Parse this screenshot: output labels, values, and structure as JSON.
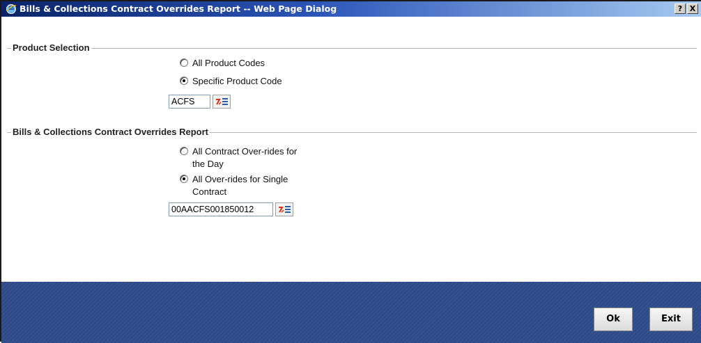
{
  "window": {
    "title": "Bills & Collections Contract Overrides Report -- Web Page Dialog",
    "help_label": "?",
    "close_label": "X"
  },
  "product_selection": {
    "section_title": "Product Selection",
    "options": [
      {
        "label": "All Product Codes",
        "checked": false
      },
      {
        "label": "Specific Product Code",
        "checked": true
      }
    ],
    "product_code_value": "ACFS"
  },
  "overrides_report": {
    "section_title": "Bills & Collections Contract Overrides Report",
    "options": [
      {
        "label_line1": "All Contract Over-rides for",
        "label_line2": "the Day",
        "checked": false
      },
      {
        "label_line1": "All Over-rides for Single",
        "label_line2": "Contract",
        "checked": true
      }
    ],
    "contract_ref_value": "00AACFS001850012"
  },
  "footer": {
    "ok_label": "Ok",
    "exit_label": "Exit"
  }
}
